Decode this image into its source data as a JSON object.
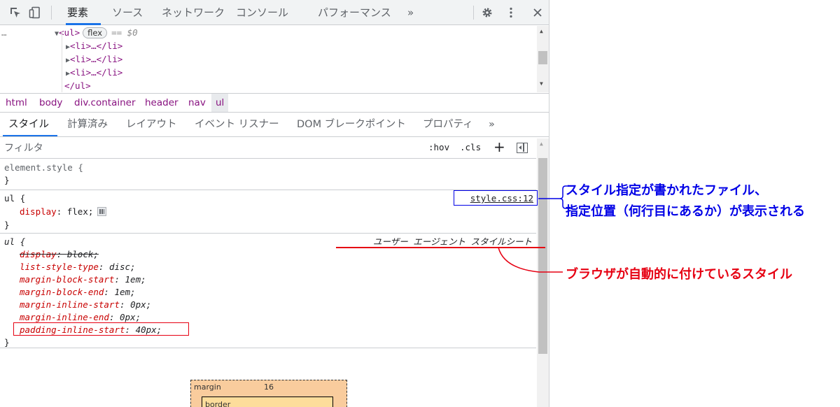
{
  "toolbar": {
    "tabs": [
      "要素",
      "ソース",
      "ネットワーク",
      "コンソール",
      "パフォーマンス"
    ],
    "more": "»"
  },
  "dom": {
    "ellipsis": "…",
    "ul_open": "<ul>",
    "ul_badge": "flex",
    "ul_marker": "== $0",
    "li_line": "<li>…</li>",
    "ul_close": "</ul>"
  },
  "breadcrumb": [
    "html",
    "body",
    "div.container",
    "header",
    "nav",
    "ul"
  ],
  "subtabs": [
    "スタイル",
    "計算済み",
    "レイアウト",
    "イベント リスナー",
    "DOM ブレークポイント",
    "プロパティ"
  ],
  "subtabs_more": "»",
  "filter": {
    "placeholder": "フィルタ",
    "hov": ":hov",
    "cls": ".cls",
    "plus": "+"
  },
  "styles": {
    "element_style": "element.style {",
    "close": "}",
    "rule1": {
      "selector": "ul {",
      "source": "style.css:12",
      "decls": [
        {
          "prop": "display",
          "value": "flex;"
        }
      ]
    },
    "rule2": {
      "selector": "ul {",
      "label": "ユーザー エージェント スタイルシート",
      "decls": [
        {
          "prop": "display",
          "value": "block;"
        },
        {
          "prop": "list-style-type",
          "value": "disc;"
        },
        {
          "prop": "margin-block-start",
          "value": "1em;"
        },
        {
          "prop": "margin-block-end",
          "value": "1em;"
        },
        {
          "prop": "margin-inline-start",
          "value": "0px;"
        },
        {
          "prop": "margin-inline-end",
          "value": "0px;"
        },
        {
          "prop": "padding-inline-start",
          "value": "40px;"
        }
      ]
    }
  },
  "boxmodel": {
    "margin_label": "margin",
    "margin_value": "16",
    "border_label": "border"
  },
  "annotations": {
    "blue_line1": "スタイル指定が書かれたファイル、",
    "blue_line2": "指定位置（何行目にあるか）が表示される",
    "red_text": "ブラウザが自動的に付けているスタイル"
  },
  "colors": {
    "annotation_blue": "#0000e6",
    "annotation_red": "#e60012",
    "accent": "#1a73e8",
    "tag": "#881280",
    "property": "#c80000"
  },
  "icons": [
    "inspect-icon",
    "device-toggle-icon",
    "settings-icon",
    "kebab-menu-icon",
    "close-icon",
    "new-style-rule-icon",
    "toggle-sidebar-icon",
    "flexbox-editor-icon"
  ]
}
